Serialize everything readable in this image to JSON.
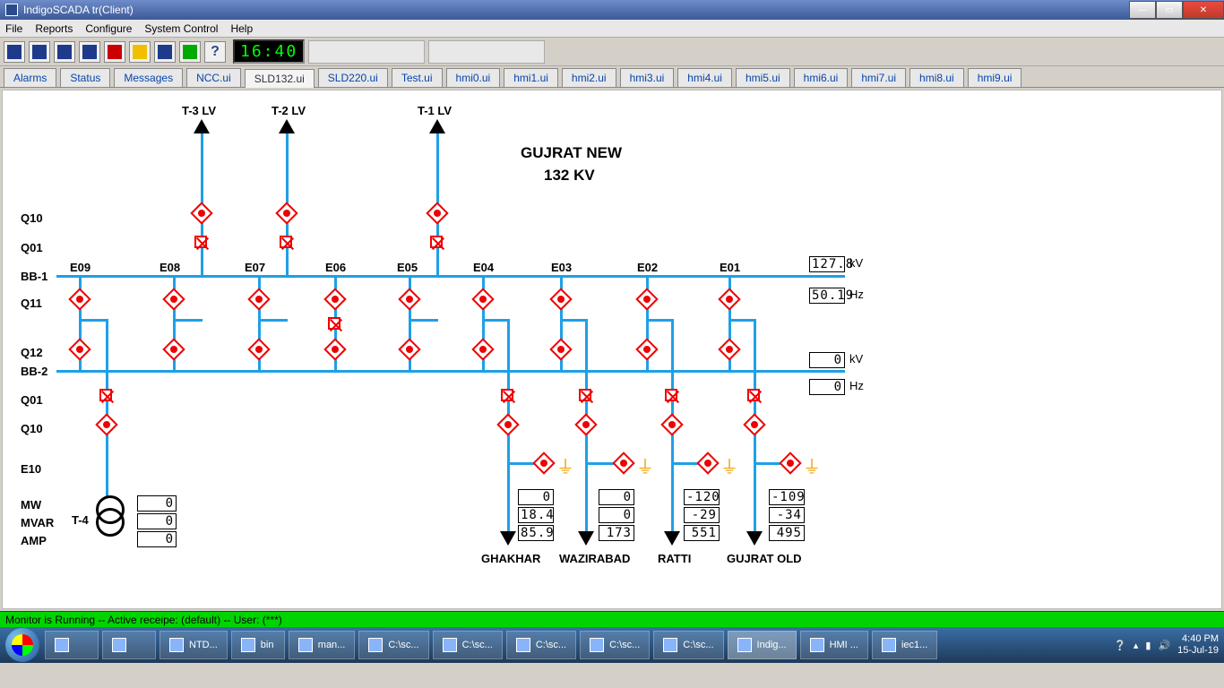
{
  "window": {
    "title": "IndigoSCADA tr(Client)"
  },
  "menu": {
    "items": [
      "File",
      "Reports",
      "Configure",
      "System Control",
      "Help"
    ]
  },
  "toolbar": {
    "clock": "16:40"
  },
  "tabs": {
    "list": [
      "Alarms",
      "Status",
      "Messages",
      "NCC.ui",
      "SLD132.ui",
      "SLD220.ui",
      "Test.ui",
      "hmi0.ui",
      "hmi1.ui",
      "hmi2.ui",
      "hmi3.ui",
      "hmi4.ui",
      "hmi5.ui",
      "hmi6.ui",
      "hmi7.ui",
      "hmi8.ui",
      "hmi9.ui"
    ],
    "active": "SLD132.ui"
  },
  "diagram": {
    "title1": "GUJRAT NEW",
    "title2": "132 KV",
    "top_feeders": {
      "t3": "T-3 LV",
      "t2": "T-2 LV",
      "t1": "T-1 LV"
    },
    "rows": {
      "q10": "Q10",
      "q01": "Q01",
      "bb1": "BB-1",
      "q11": "Q11",
      "q12": "Q12",
      "bb2": "BB-2",
      "q01b": "Q01",
      "q10b": "Q10",
      "e10": "E10",
      "mw": "MW",
      "mvar": "MVAR",
      "amp": "AMP",
      "t4": "T-4"
    },
    "bays": {
      "e01": "E01",
      "e02": "E02",
      "e03": "E03",
      "e04": "E04",
      "e05": "E05",
      "e06": "E06",
      "e07": "E07",
      "e08": "E08",
      "e09": "E09"
    },
    "feeders": {
      "ghakhar": "GHAKHAR",
      "wazirabad": "WAZIRABAD",
      "ratti": "RATTI",
      "gujrat_old": "GUJRAT OLD"
    },
    "bb1_kv": "127.8",
    "bb1_hz": "50.19",
    "bb2_kv": "0",
    "bb2_hz": "0",
    "kv_label": "kV",
    "hz_label": "Hz",
    "t4": {
      "mw": "0",
      "mvar": "0",
      "amp": "0"
    },
    "feeder_vals": {
      "ghakhar": {
        "mw": "0",
        "mvar": "18.4",
        "amp": "85.9"
      },
      "wazirabad": {
        "mw": "0",
        "mvar": "0",
        "amp": "173"
      },
      "ratti": {
        "mw": "-120",
        "mvar": "-29",
        "amp": "551"
      },
      "gujrat_old": {
        "mw": "-109",
        "mvar": "-34",
        "amp": "495"
      }
    }
  },
  "status": {
    "text": "Monitor is Running -- Active receipe: (default) -- User: (***)"
  },
  "taskbar": {
    "items": [
      "NTD...",
      "bin",
      "man...",
      "C:\\sc...",
      "C:\\sc...",
      "C:\\sc...",
      "C:\\sc...",
      "C:\\sc...",
      "Indig...",
      "HMI ...",
      "iec1..."
    ],
    "time": "4:40 PM",
    "date": "15-Jul-19"
  }
}
